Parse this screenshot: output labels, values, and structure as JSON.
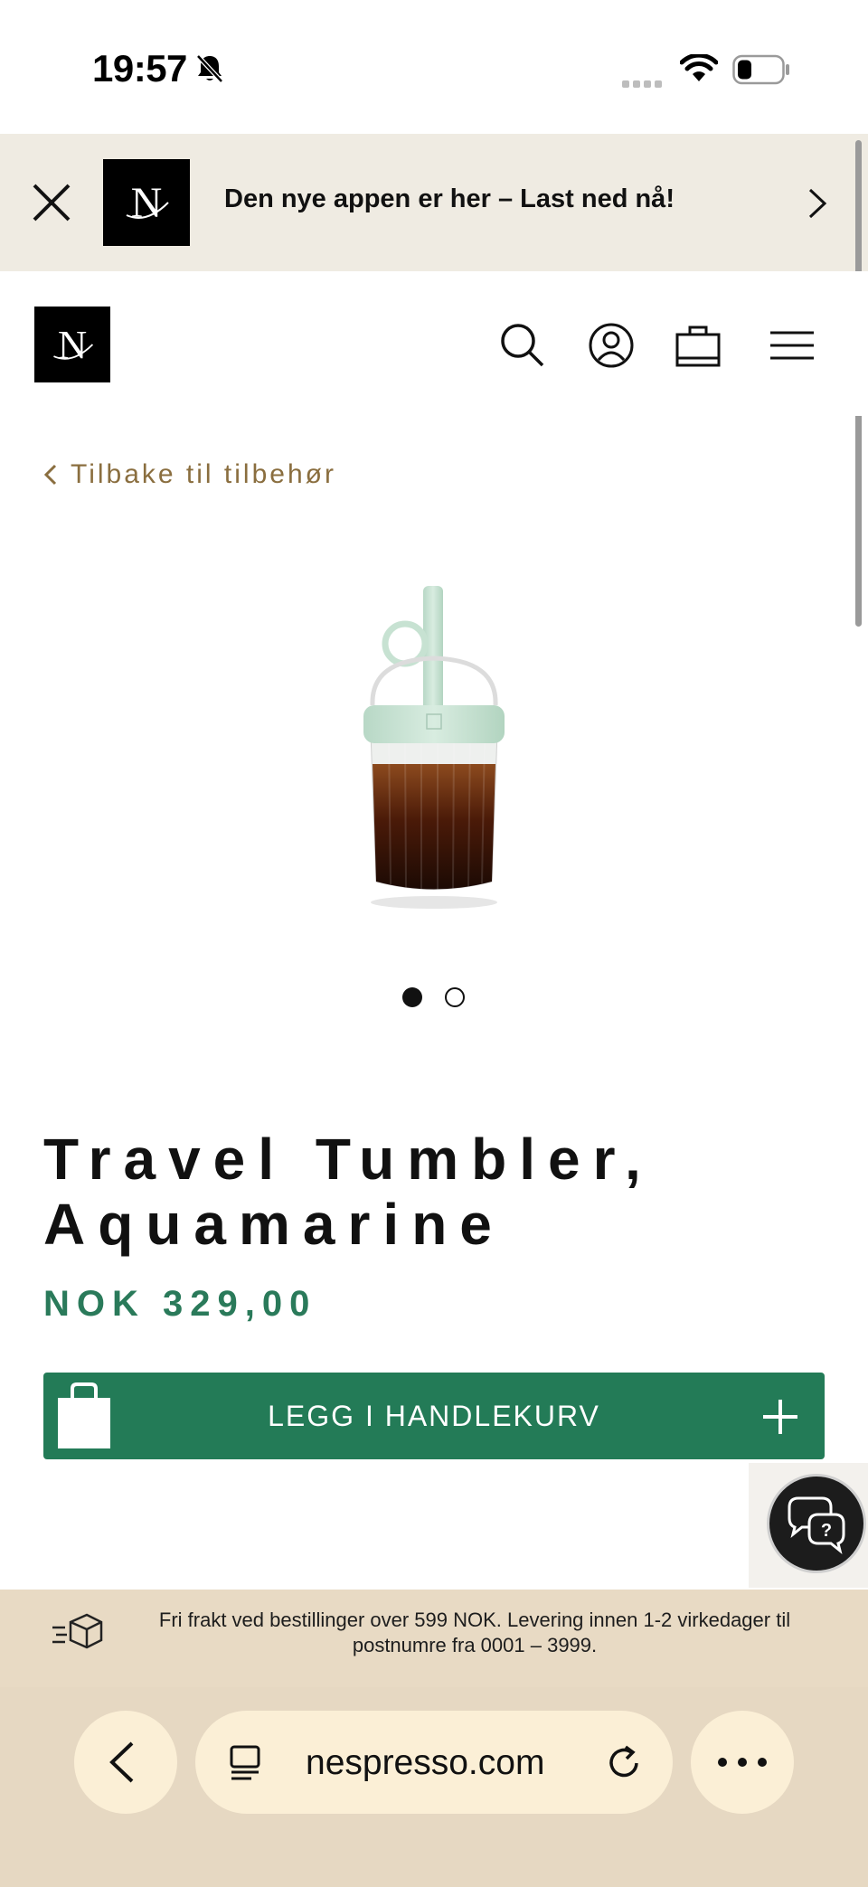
{
  "status_bar": {
    "time": "19:57",
    "icons": [
      "bell-muted-icon",
      "signal-icon",
      "wifi-icon",
      "battery-icon"
    ]
  },
  "app_banner": {
    "text": "Den nye appen er her – Last ned nå!",
    "icons": [
      "close-icon",
      "nespresso-logo",
      "chevron-right-icon"
    ]
  },
  "header": {
    "icons": [
      "nespresso-logo",
      "search-icon",
      "account-icon",
      "bag-icon",
      "menu-icon"
    ]
  },
  "breadcrumb": {
    "back_label": "Tilbake til tilbehør"
  },
  "product": {
    "title": "Travel Tumbler, Aquamarine",
    "price": "NOK 329,00",
    "carousel_total": 2,
    "carousel_active": 1
  },
  "add_to_cart": {
    "label": "LEGG I HANDLEKURV",
    "icons": [
      "bag-icon",
      "plus-icon"
    ]
  },
  "chat": {
    "icon": "chat-help-icon"
  },
  "shipping": {
    "text": "Fri frakt ved bestillinger over 599 NOK. Levering innen 1-2 virkedager til postnumre fra 0001 – 3999.",
    "icon": "shipping-box-icon"
  },
  "browser": {
    "url": "nespresso.com",
    "icons": [
      "back-icon",
      "tabs-icon",
      "reload-icon",
      "more-icon"
    ]
  },
  "colors": {
    "brand_green": "#237b57",
    "price_green": "#2a7a5a",
    "back_link_gold": "#8a6e3f",
    "banner_bg": "#efebe2",
    "shipping_bg": "#e8dac4",
    "browser_bg": "#e6d8c2"
  }
}
